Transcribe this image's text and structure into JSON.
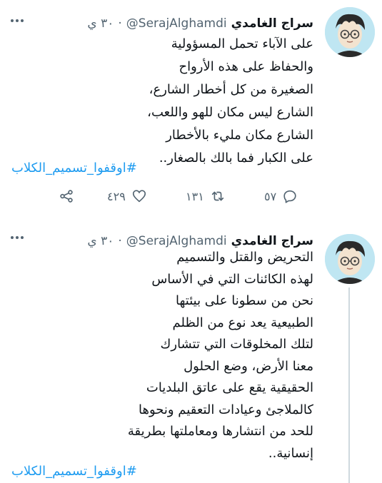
{
  "tweets": [
    {
      "author": {
        "name": "سراج الغامدي",
        "handle": "@SerajAlghamdi",
        "time": "٣٠ ي"
      },
      "text_lines": [
        "على الآباء تحمل المسؤولية",
        "والحفاظ على هذه الأرواح",
        "الصغيرة من كل أخطار الشارع،",
        "الشارع ليس مكان للهو واللعب،",
        "الشارع مكان مليء بالأخطار",
        "على الكبار فما بالك بالصغار.."
      ],
      "hashtag": "#اوقفوا_تسميم_الكلاب",
      "stats": {
        "replies": "٥٧",
        "retweets": "١٣١",
        "likes": "٤٢٩"
      }
    },
    {
      "author": {
        "name": "سراج الغامدي",
        "handle": "@SerajAlghamdi",
        "time": "٣٠ ي"
      },
      "text_lines": [
        "التحريض والقتل والتسميم",
        "لهذه الكائنات التي في الأساس",
        "نحن من سطونا على بيئتها",
        "الطبيعية يعد نوع من الظلم",
        "لتلك المخلوقات التي تتشارك",
        "معنا الأرض، وضع الحلول",
        "الحقيقية يقع على عاتق البلديات",
        "كالملاجئ وعيادات التعقيم ونحوها",
        "للحد من انتشارها ومعاملتها بطريقة",
        "إنسانية.."
      ],
      "hashtag": "#اوقفوا_تسميم_الكلاب"
    }
  ],
  "icons": {
    "reply": "reply-icon",
    "retweet": "retweet-icon",
    "like": "heart-icon",
    "share": "share-icon",
    "more": "more-icon"
  },
  "colors": {
    "accent": "#1d9bf0",
    "muted": "#536471",
    "text": "#0f1419"
  }
}
